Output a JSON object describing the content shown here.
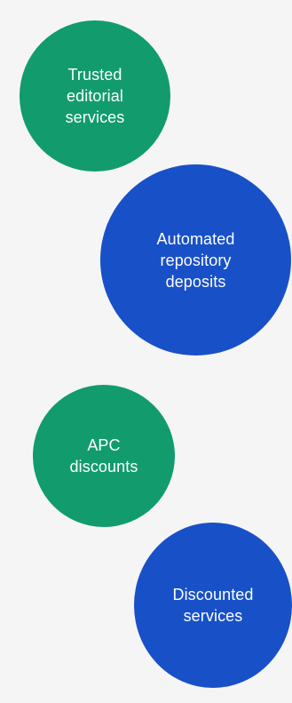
{
  "colors": {
    "background": "#f5f5f6",
    "green": "#129c6d",
    "blue": "#1750c7",
    "text": "#ffffff"
  },
  "bubbles": [
    {
      "label": "Trusted\neditorial\nservices",
      "color": "green"
    },
    {
      "label": "Automated\nrepository\ndeposits",
      "color": "blue"
    },
    {
      "label": "APC\ndiscounts",
      "color": "green"
    },
    {
      "label": "Discounted\nservices",
      "color": "blue"
    }
  ]
}
